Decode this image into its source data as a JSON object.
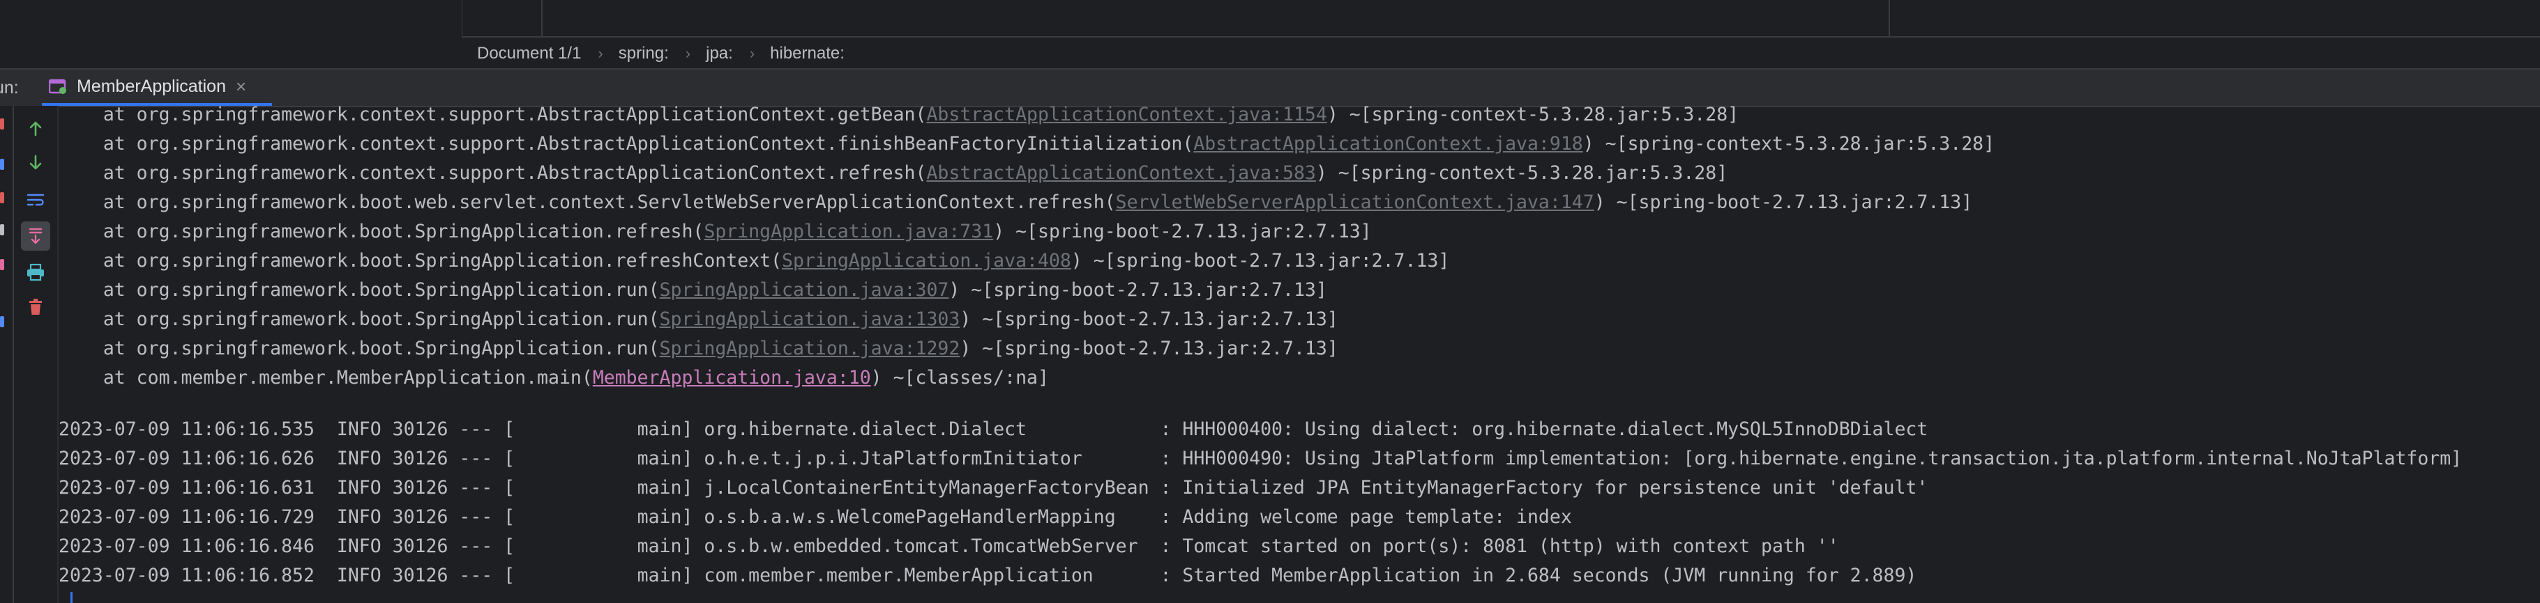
{
  "breadcrumb": {
    "items": [
      "Document 1/1",
      "spring:",
      "jpa:",
      "hibernate:"
    ]
  },
  "run_panel": {
    "label": "un:",
    "tab_label": "MemberApplication",
    "close_glyph": "×"
  },
  "toolbar": {
    "icons": [
      "arrow-up-icon",
      "arrow-down-icon",
      "soft-wrap-icon",
      "scroll-to-end-icon",
      "print-icon",
      "trash-icon"
    ]
  },
  "console": {
    "stack": [
      {
        "pre": "    at org.springframework.context.support.AbstractApplicationContext.getBean(",
        "link": "AbstractApplicationContext.java:1154",
        "post": ") ~[spring-context-5.3.28.jar:5.3.28]"
      },
      {
        "pre": "    at org.springframework.context.support.AbstractApplicationContext.finishBeanFactoryInitialization(",
        "link": "AbstractApplicationContext.java:918",
        "post": ") ~[spring-context-5.3.28.jar:5.3.28]"
      },
      {
        "pre": "    at org.springframework.context.support.AbstractApplicationContext.refresh(",
        "link": "AbstractApplicationContext.java:583",
        "post": ") ~[spring-context-5.3.28.jar:5.3.28]"
      },
      {
        "pre": "    at org.springframework.boot.web.servlet.context.ServletWebServerApplicationContext.refresh(",
        "link": "ServletWebServerApplicationContext.java:147",
        "post": ") ~[spring-boot-2.7.13.jar:2.7.13]"
      },
      {
        "pre": "    at org.springframework.boot.SpringApplication.refresh(",
        "link": "SpringApplication.java:731",
        "post": ") ~[spring-boot-2.7.13.jar:2.7.13]"
      },
      {
        "pre": "    at org.springframework.boot.SpringApplication.refreshContext(",
        "link": "SpringApplication.java:408",
        "post": ") ~[spring-boot-2.7.13.jar:2.7.13]"
      },
      {
        "pre": "    at org.springframework.boot.SpringApplication.run(",
        "link": "SpringApplication.java:307",
        "post": ") ~[spring-boot-2.7.13.jar:2.7.13]"
      },
      {
        "pre": "    at org.springframework.boot.SpringApplication.run(",
        "link": "SpringApplication.java:1303",
        "post": ") ~[spring-boot-2.7.13.jar:2.7.13]"
      },
      {
        "pre": "    at org.springframework.boot.SpringApplication.run(",
        "link": "SpringApplication.java:1292",
        "post": ") ~[spring-boot-2.7.13.jar:2.7.13]"
      },
      {
        "pre": "    at com.member.member.MemberApplication.main(",
        "link": "MemberApplication.java:10",
        "post": ") ~[classes/:na]"
      }
    ],
    "logs": [
      "2023-07-09 11:06:16.535  INFO 30126 --- [           main] org.hibernate.dialect.Dialect            : HHH000400: Using dialect: org.hibernate.dialect.MySQL5InnoDBDialect",
      "2023-07-09 11:06:16.626  INFO 30126 --- [           main] o.h.e.t.j.p.i.JtaPlatformInitiator       : HHH000490: Using JtaPlatform implementation: [org.hibernate.engine.transaction.jta.platform.internal.NoJtaPlatform]",
      "2023-07-09 11:06:16.631  INFO 30126 --- [           main] j.LocalContainerEntityManagerFactoryBean : Initialized JPA EntityManagerFactory for persistence unit 'default'",
      "2023-07-09 11:06:16.729  INFO 30126 --- [           main] o.s.b.a.w.s.WelcomePageHandlerMapping    : Adding welcome page template: index",
      "2023-07-09 11:06:16.846  INFO 30126 --- [           main] o.s.b.w.embedded.tomcat.TomcatWebServer  : Tomcat started on port(s): 8081 (http) with context path ''",
      "2023-07-09 11:06:16.852  INFO 30126 --- [           main] com.member.member.MemberApplication      : Started MemberApplication in 2.684 seconds (JVM running for 2.889)"
    ]
  },
  "colors": {
    "background": "#1e1f22",
    "text": "#bcbec4",
    "link": "#6f737a",
    "link_highlight": "#c77dbb",
    "accent": "#3574f0",
    "tool_green": "#5fb865",
    "tool_blue": "#548af7",
    "tool_red": "#db5c5c",
    "tool_teal": "#4eb8ca",
    "tool_pink": "#e06c9f"
  }
}
